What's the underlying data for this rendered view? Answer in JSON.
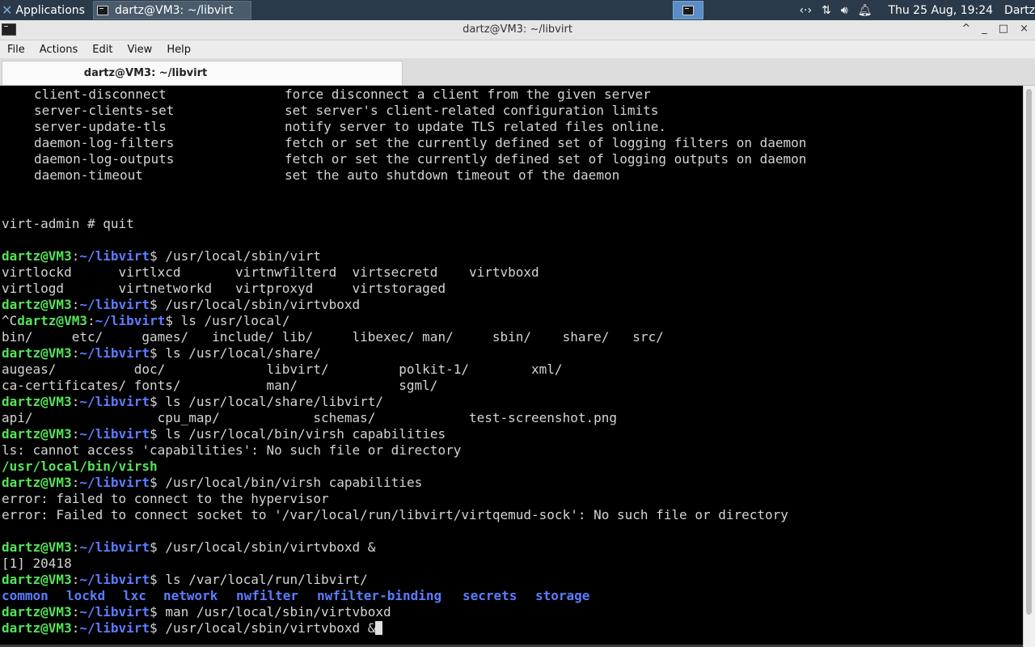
{
  "panel": {
    "applications_label": "Applications",
    "task_label": "dartz@VM3: ~/libvirt",
    "clock": "Thu 25 Aug, 19:24",
    "user": "Dartz",
    "tray_icons": [
      "network-icon",
      "transfer-icon",
      "volume-icon",
      "notification-bell-icon"
    ]
  },
  "window": {
    "title": "dartz@VM3: ~/libvirt",
    "controls": [
      "^",
      "_",
      "□",
      "×"
    ]
  },
  "menu": [
    "File",
    "Actions",
    "Edit",
    "View",
    "Help"
  ],
  "tab": {
    "label": "dartz@VM3: ~/libvirt"
  },
  "terminal": {
    "prompt_user": "dartz@VM3",
    "prompt_path": "~/libvirt",
    "help_rows": [
      {
        "cmd": "client-disconnect",
        "desc": "force disconnect a client from the given server"
      },
      {
        "cmd": "server-clients-set",
        "desc": "set server's client-related configuration limits"
      },
      {
        "cmd": "server-update-tls",
        "desc": "notify server to update TLS related files online."
      },
      {
        "cmd": "daemon-log-filters",
        "desc": "fetch or set the currently defined set of logging filters on daemon"
      },
      {
        "cmd": "daemon-log-outputs",
        "desc": "fetch or set the currently defined set of logging outputs on daemon"
      },
      {
        "cmd": "daemon-timeout",
        "desc": "set the auto shutdown timeout of the daemon"
      }
    ],
    "quit_line": "virt-admin # quit",
    "cmd1": " /usr/local/sbin/virt",
    "completion1": "virtlockd      virtlxcd       virtnwfilterd  virtsecretd    virtvboxd",
    "completion2": "virtlogd       virtnetworkd   virtproxyd     virtstoraged",
    "cmd2": " /usr/local/sbin/virtvboxd",
    "ctrl_c": "^C",
    "cmd3": " ls /usr/local/",
    "ls1": "bin/     etc/     games/   include/ lib/     libexec/ man/     sbin/    share/   src/",
    "cmd4": " ls /usr/local/share/",
    "ls2a": "augeas/          doc/             libvirt/         polkit-1/        xml/",
    "ls2b": "ca-certificates/ fonts/           man/             sgml/",
    "cmd5": " ls /usr/local/share/libvirt/",
    "ls3": "api/                cpu_map/            schemas/            test-screenshot.png",
    "cmd6": " ls /usr/local/bin/virsh capabilities",
    "err1": "ls: cannot access 'capabilities': No such file or directory",
    "exe": "/usr/local/bin/virsh",
    "cmd7": " /usr/local/bin/virsh capabilities",
    "err2": "error: failed to connect to the hypervisor",
    "err3": "error: Failed to connect socket to '/var/local/run/libvirt/virtqemud-sock': No such file or directory",
    "cmd8": " /usr/local/sbin/virtvboxd &",
    "job": "[1] 20418",
    "cmd9": " ls /var/local/run/libvirt/",
    "dirs": [
      "common",
      "lockd",
      "lxc",
      "network",
      "nwfilter",
      "nwfilter-binding",
      "secrets",
      "storage"
    ],
    "cmd10": " man /usr/local/sbin/virtvboxd",
    "cmd11": " /usr/local/sbin/virtvboxd &"
  }
}
